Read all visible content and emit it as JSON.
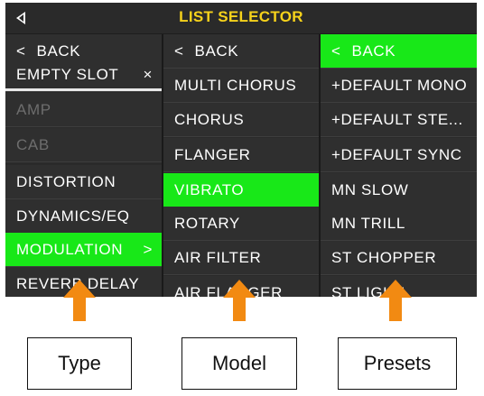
{
  "header": {
    "title": "LIST SELECTOR",
    "back_icon": "triangle-left"
  },
  "columns": {
    "type": {
      "back": "BACK",
      "items": [
        {
          "label": "EMPTY SLOT",
          "glyph": "×",
          "state": "active"
        },
        {
          "label": "AMP",
          "state": "disabled"
        },
        {
          "label": "CAB",
          "state": "disabled"
        },
        {
          "label": "DISTORTION",
          "state": "normal"
        },
        {
          "label": "DYNAMICS/EQ",
          "state": "normal"
        },
        {
          "label": "MODULATION",
          "glyph": ">",
          "state": "selected"
        },
        {
          "label": "REVERB DELAY",
          "state": "normal"
        }
      ]
    },
    "model": {
      "back": "BACK",
      "items": [
        {
          "label": "MULTI CHORUS"
        },
        {
          "label": "CHORUS"
        },
        {
          "label": "FLANGER"
        },
        {
          "label": "VIBRATO",
          "state": "selected"
        },
        {
          "label": "ROTARY"
        },
        {
          "label": "AIR FILTER"
        },
        {
          "label": "AIR FLANGER"
        }
      ]
    },
    "presets": {
      "back": "BACK",
      "back_state": "selected",
      "items": [
        {
          "label": "+DEFAULT MONO"
        },
        {
          "label": "+DEFAULT STE..."
        },
        {
          "label": "+DEFAULT SYNC"
        },
        {
          "label": "MN SLOW"
        },
        {
          "label": "MN TRILL"
        },
        {
          "label": "ST CHOPPER"
        },
        {
          "label": "ST LIGHT"
        }
      ]
    }
  },
  "callouts": {
    "type": "Type",
    "model": "Model",
    "presets": "Presets"
  },
  "colors": {
    "accent_green": "#18e818",
    "title_yellow": "#f6d21b",
    "arrow_orange": "#f28a12",
    "panel": "#2f2f2f"
  }
}
